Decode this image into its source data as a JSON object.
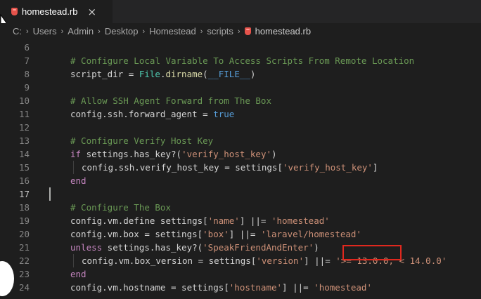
{
  "tab": {
    "title": "homestead.rb",
    "close_glyph": "×"
  },
  "breadcrumb": {
    "parts": [
      "C:",
      "Users",
      "Admin",
      "Desktop",
      "Homestead",
      "scripts"
    ],
    "file": "homestead.rb",
    "separator": "›"
  },
  "lines": [
    {
      "n": "6",
      "segs": []
    },
    {
      "n": "7",
      "segs": [
        {
          "t": "# Configure Local Variable To Access Scripts From Remote Location",
          "c": "c-comment"
        }
      ]
    },
    {
      "n": "8",
      "segs": [
        {
          "t": "script_dir = "
        },
        {
          "t": "File",
          "c": "c-const"
        },
        {
          "t": "."
        },
        {
          "t": "dirname",
          "c": "c-fn"
        },
        {
          "t": "("
        },
        {
          "t": "__FILE__",
          "c": "c-bool"
        },
        {
          "t": ")"
        }
      ]
    },
    {
      "n": "9",
      "segs": []
    },
    {
      "n": "10",
      "segs": [
        {
          "t": "# Allow SSH Agent Forward from The Box",
          "c": "c-comment"
        }
      ]
    },
    {
      "n": "11",
      "segs": [
        {
          "t": "config.ssh.forward_agent = "
        },
        {
          "t": "true",
          "c": "c-bool"
        }
      ]
    },
    {
      "n": "12",
      "segs": []
    },
    {
      "n": "13",
      "segs": [
        {
          "t": "# Configure Verify Host Key",
          "c": "c-comment"
        }
      ]
    },
    {
      "n": "14",
      "segs": [
        {
          "t": "if",
          "c": "c-kw"
        },
        {
          "t": " settings.has_key?("
        },
        {
          "t": "'verify_host_key'",
          "c": "c-str"
        },
        {
          "t": ")"
        }
      ]
    },
    {
      "n": "15",
      "indent": true,
      "segs": [
        {
          "t": "config.ssh.verify_host_key = settings["
        },
        {
          "t": "'verify_host_key'",
          "c": "c-str"
        },
        {
          "t": "]"
        }
      ]
    },
    {
      "n": "16",
      "segs": [
        {
          "t": "end",
          "c": "c-kw"
        }
      ]
    },
    {
      "n": "17",
      "active": true,
      "segs": []
    },
    {
      "n": "18",
      "segs": [
        {
          "t": "# Configure The Box",
          "c": "c-comment"
        }
      ]
    },
    {
      "n": "19",
      "segs": [
        {
          "t": "config.vm.define settings["
        },
        {
          "t": "'name'",
          "c": "c-str"
        },
        {
          "t": "] ||= "
        },
        {
          "t": "'homestead'",
          "c": "c-str"
        }
      ]
    },
    {
      "n": "20",
      "segs": [
        {
          "t": "config.vm.box = settings["
        },
        {
          "t": "'box'",
          "c": "c-str"
        },
        {
          "t": "] ||= "
        },
        {
          "t": "'laravel/homestead'",
          "c": "c-str"
        }
      ]
    },
    {
      "n": "21",
      "segs": [
        {
          "t": "unless",
          "c": "c-kw"
        },
        {
          "t": " settings.has_key?("
        },
        {
          "t": "'SpeakFriendAndEnter'",
          "c": "c-str"
        },
        {
          "t": ")"
        }
      ]
    },
    {
      "n": "22",
      "indent": true,
      "segs": [
        {
          "t": "config.vm.box_version = settings["
        },
        {
          "t": "'version'",
          "c": "c-str"
        },
        {
          "t": "] ||= "
        },
        {
          "t": "'>= 13.0.0, < 14.0.0'",
          "c": "c-str"
        }
      ]
    },
    {
      "n": "23",
      "segs": [
        {
          "t": "end",
          "c": "c-kw"
        }
      ]
    },
    {
      "n": "24",
      "segs": [
        {
          "t": "config.vm.hostname = settings["
        },
        {
          "t": "'hostname'",
          "c": "c-str"
        },
        {
          "t": "] ||= "
        },
        {
          "t": "'homestead'",
          "c": "c-str"
        }
      ]
    }
  ],
  "colors": {
    "background": "#1e1e1e",
    "highlight_box": "#e0281e"
  }
}
